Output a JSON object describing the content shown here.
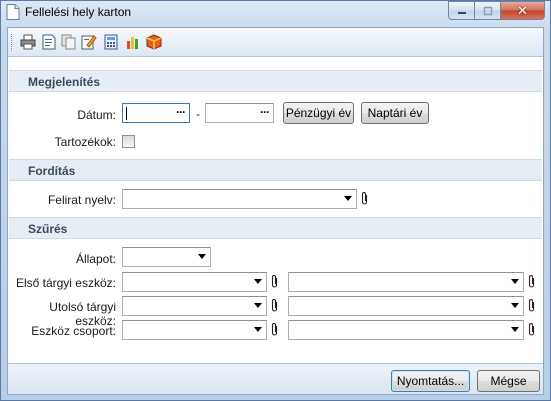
{
  "window": {
    "title": "Fellelési hely karton"
  },
  "toolbar": {
    "buttons": [
      "print-icon",
      "preview-icon",
      "copy-icon",
      "edit-icon",
      "calculator-icon",
      "chart-icon",
      "package-icon"
    ]
  },
  "sections": {
    "display": "Megjelenítés",
    "translation": "Fordítás",
    "filter": "Szűrés"
  },
  "display": {
    "date_label": "Dátum:",
    "date_from": "",
    "date_separator": "-",
    "date_to": "",
    "fiscal_year_button": "Pénzügyi év",
    "calendar_year_button": "Naptári év",
    "accessories_label": "Tartozékok:",
    "accessories_checked": false
  },
  "translation": {
    "caption_lang_label": "Felirat nyelv:",
    "caption_lang_value": ""
  },
  "filter": {
    "status_label": "Állapot:",
    "status_value": "",
    "first_asset_label": "Első tárgyi eszköz:",
    "last_asset_label": "Utolsó tárgyi eszköz:",
    "asset_group_label": "Eszköz csoport:"
  },
  "footer": {
    "print_button": "Nyomtatás...",
    "cancel_button": "Mégse"
  },
  "colors": {
    "window_frame": "#b9cde6",
    "section_header_bg": "#e7edf5",
    "section_header_text": "#3a4a5e",
    "default_button_border": "#3c7fb1"
  }
}
